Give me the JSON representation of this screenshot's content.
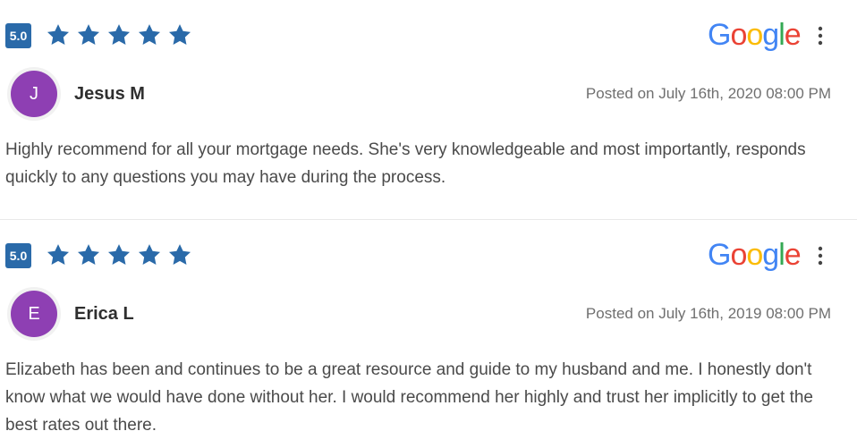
{
  "reviews": [
    {
      "rating": "5.0",
      "stars": 5,
      "source_logo": "Google",
      "author_initial": "J",
      "author_name": "Jesus M",
      "posted": "Posted on July 16th, 2020 08:00 PM",
      "text": "Highly recommend for all your mortgage needs. She's very knowledgeable and most importantly, responds quickly to any questions you may have during the process."
    },
    {
      "rating": "5.0",
      "stars": 5,
      "source_logo": "Google",
      "author_initial": "E",
      "author_name": "Erica L",
      "posted": "Posted on July 16th, 2019 08:00 PM",
      "text": "Elizabeth has been and continues to be a great resource and guide to my husband and me. I honestly don't know what we would have done without her. I would recommend her highly and trust her implicitly to get the best rates out there."
    }
  ],
  "colors": {
    "star": "#2a6aa9",
    "badge": "#2a6aa9",
    "avatar": "#8e3fb3",
    "google_blue": "#4285f4",
    "google_red": "#ea4335",
    "google_yellow": "#fbbc05",
    "google_green": "#34a853"
  },
  "icons": {
    "star": "star-icon",
    "more": "more-vertical-icon",
    "logo": "google-logo"
  }
}
